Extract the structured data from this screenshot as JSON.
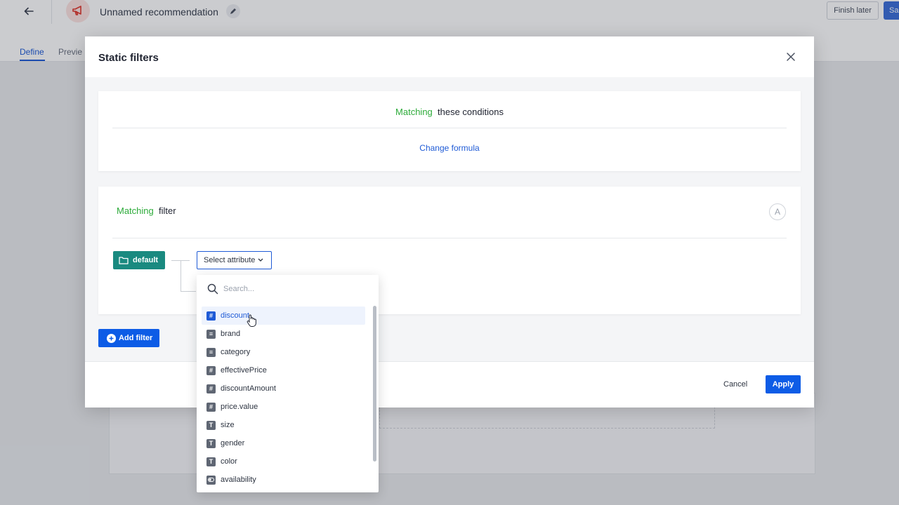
{
  "app": {
    "title": "Unnamed recommendation",
    "finish_later": "Finish later",
    "save_label": "Sa",
    "tabs": [
      {
        "label": "Define",
        "active": true
      },
      {
        "label": "Previe",
        "active": false
      }
    ]
  },
  "modal": {
    "title": "Static filters",
    "formula": {
      "matching": "Matching",
      "rest": "these conditions",
      "change_label": "Change formula"
    },
    "filter": {
      "matching": "Matching",
      "rest": "filter",
      "badge": "A",
      "group_label": "default",
      "select_label": "Select attribute"
    },
    "add_filter_label": "Add filter",
    "cancel_label": "Cancel",
    "apply_label": "Apply"
  },
  "dropdown": {
    "search_placeholder": "Search...",
    "items": [
      {
        "label": "discount",
        "type_icon": "number-icon",
        "highlighted": true
      },
      {
        "label": "brand",
        "type_icon": "list-icon",
        "highlighted": false
      },
      {
        "label": "category",
        "type_icon": "list-icon",
        "highlighted": false
      },
      {
        "label": "effectivePrice",
        "type_icon": "number-icon",
        "highlighted": false
      },
      {
        "label": "discountAmount",
        "type_icon": "number-icon",
        "highlighted": false
      },
      {
        "label": "price.value",
        "type_icon": "number-icon",
        "highlighted": false
      },
      {
        "label": "size",
        "type_icon": "text-icon",
        "highlighted": false
      },
      {
        "label": "gender",
        "type_icon": "text-icon",
        "highlighted": false
      },
      {
        "label": "color",
        "type_icon": "text-icon",
        "highlighted": false
      },
      {
        "label": "availability",
        "type_icon": "boolean-icon",
        "highlighted": false
      }
    ]
  },
  "colors": {
    "accent": "#0d5ce6",
    "matching_green": "#2dab3a",
    "default_chip": "#1a8a80"
  }
}
